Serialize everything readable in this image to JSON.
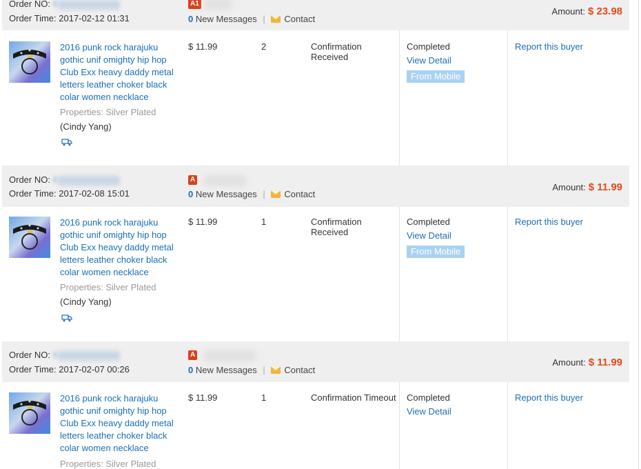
{
  "labels": {
    "order_no": "Order NO:",
    "order_time": "Order Time:",
    "new_messages": "New Messages",
    "contact": "Contact",
    "amount": "Amount:",
    "properties_prefix": "Properties:",
    "report": "Report this buyer",
    "view_detail": "View Detail",
    "from_mobile": "From Mobile"
  },
  "colors": {
    "link": "#1a6fb5",
    "amount": "#e64a19",
    "header_bg": "#efefef",
    "mobile_tag": "#a9d2f2",
    "seller_badge": "#d9411b"
  },
  "orders": [
    {
      "order_no_visible": "8",
      "order_time": "2017-02-12 01:31",
      "seller_badge": "A1",
      "new_message_count": "0",
      "amount": "$ 23.98",
      "product_title": "2016 punk rock harajuku gothic unif omighty hip hop Club Exx heavy daddy metal letters leather choker black colar women necklace",
      "properties": "Silver Plated",
      "buyer_name": "(Cindy Yang)",
      "price": "$ 11.99",
      "quantity": "2",
      "confirmation": "Confirmation Received",
      "status": "Completed",
      "from_mobile": true
    },
    {
      "order_no_visible": "8",
      "order_time": "2017-02-08 15:01",
      "seller_badge": "A",
      "new_message_count": "0",
      "amount": "$ 11.99",
      "product_title": "2016 punk rock harajuku gothic unif omighty hip hop Club Exx heavy daddy metal letters leather choker black colar women necklace",
      "properties": "Silver Plated",
      "buyer_name": "(Cindy Yang)",
      "price": "$ 11.99",
      "quantity": "1",
      "confirmation": "Confirmation Received",
      "status": "Completed",
      "from_mobile": true
    },
    {
      "order_no_visible": "8",
      "order_time": "2017-02-07 00:26",
      "seller_badge": "A",
      "new_message_count": "0",
      "amount": "$ 11.99",
      "product_title": "2016 punk rock harajuku gothic unif omighty hip hop Club Exx heavy daddy metal letters leather choker black colar women necklace",
      "properties": "Silver Plated",
      "buyer_name": "",
      "price": "$ 11.99",
      "quantity": "1",
      "confirmation": "Confirmation Timeout",
      "status": "Completed",
      "from_mobile": false
    }
  ]
}
